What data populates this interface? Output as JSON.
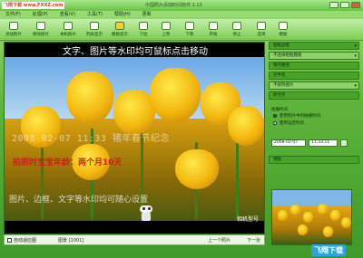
{
  "window": {
    "site_logo": "飞翔下载 www.FXXZ.com",
    "title": "中国照片添加时间软件 1.13"
  },
  "menu": [
    "文件(F)",
    "处理(P)",
    "查看(V)",
    "工具(T)",
    "帮助(H)",
    "更新"
  ],
  "toolbar": [
    {
      "label": "添加照片",
      "icon": "add-photo-icon"
    },
    {
      "label": "移除照片",
      "icon": "remove-photo-icon"
    },
    {
      "label": "本机照片",
      "icon": "local-photos-icon"
    },
    {
      "label": "列表显示",
      "icon": "list-view-icon"
    },
    {
      "label": "模板提示",
      "icon": "template-icon"
    },
    {
      "label": "下拉",
      "icon": "dropdown-icon"
    },
    {
      "label": "上移",
      "icon": "move-up-icon"
    },
    {
      "label": "下移",
      "icon": "move-down-icon"
    },
    {
      "label": "开始",
      "icon": "start-icon"
    },
    {
      "label": "停止",
      "icon": "stop-icon"
    },
    {
      "label": "选项",
      "icon": "options-icon"
    },
    {
      "label": "模板",
      "icon": "template-library-icon"
    }
  ],
  "preview": {
    "top_watermark": "文字、图片等水印均可鼠标点击移动",
    "date_watermark": "2008-02-07 11:33 猪年春节纪念",
    "baby_watermark": "拍照时宝宝年龄：两个月10天",
    "frame_watermark": "图片、边框、文字等水印均可随心设置",
    "camera_model": "相机型号"
  },
  "status": {
    "auto_fit_label": "自动适应图",
    "filename": "图景 [1001]",
    "prev_label": "上一个照片",
    "next_label": "下一张"
  },
  "panel": {
    "row1": "相框边框",
    "row2": "不选择相框模板",
    "row3": "保存路径",
    "row4": "文件名",
    "row5": "不修改图片",
    "row6": "原文件",
    "label_time": "拍摄时间",
    "radio1": "使用照片中的拍摄时间",
    "radio2": "使用设定时间",
    "date_value": "2008-02-07",
    "time_value": "11:33:11",
    "row7": "相框"
  },
  "brand": "飞翔下载"
}
